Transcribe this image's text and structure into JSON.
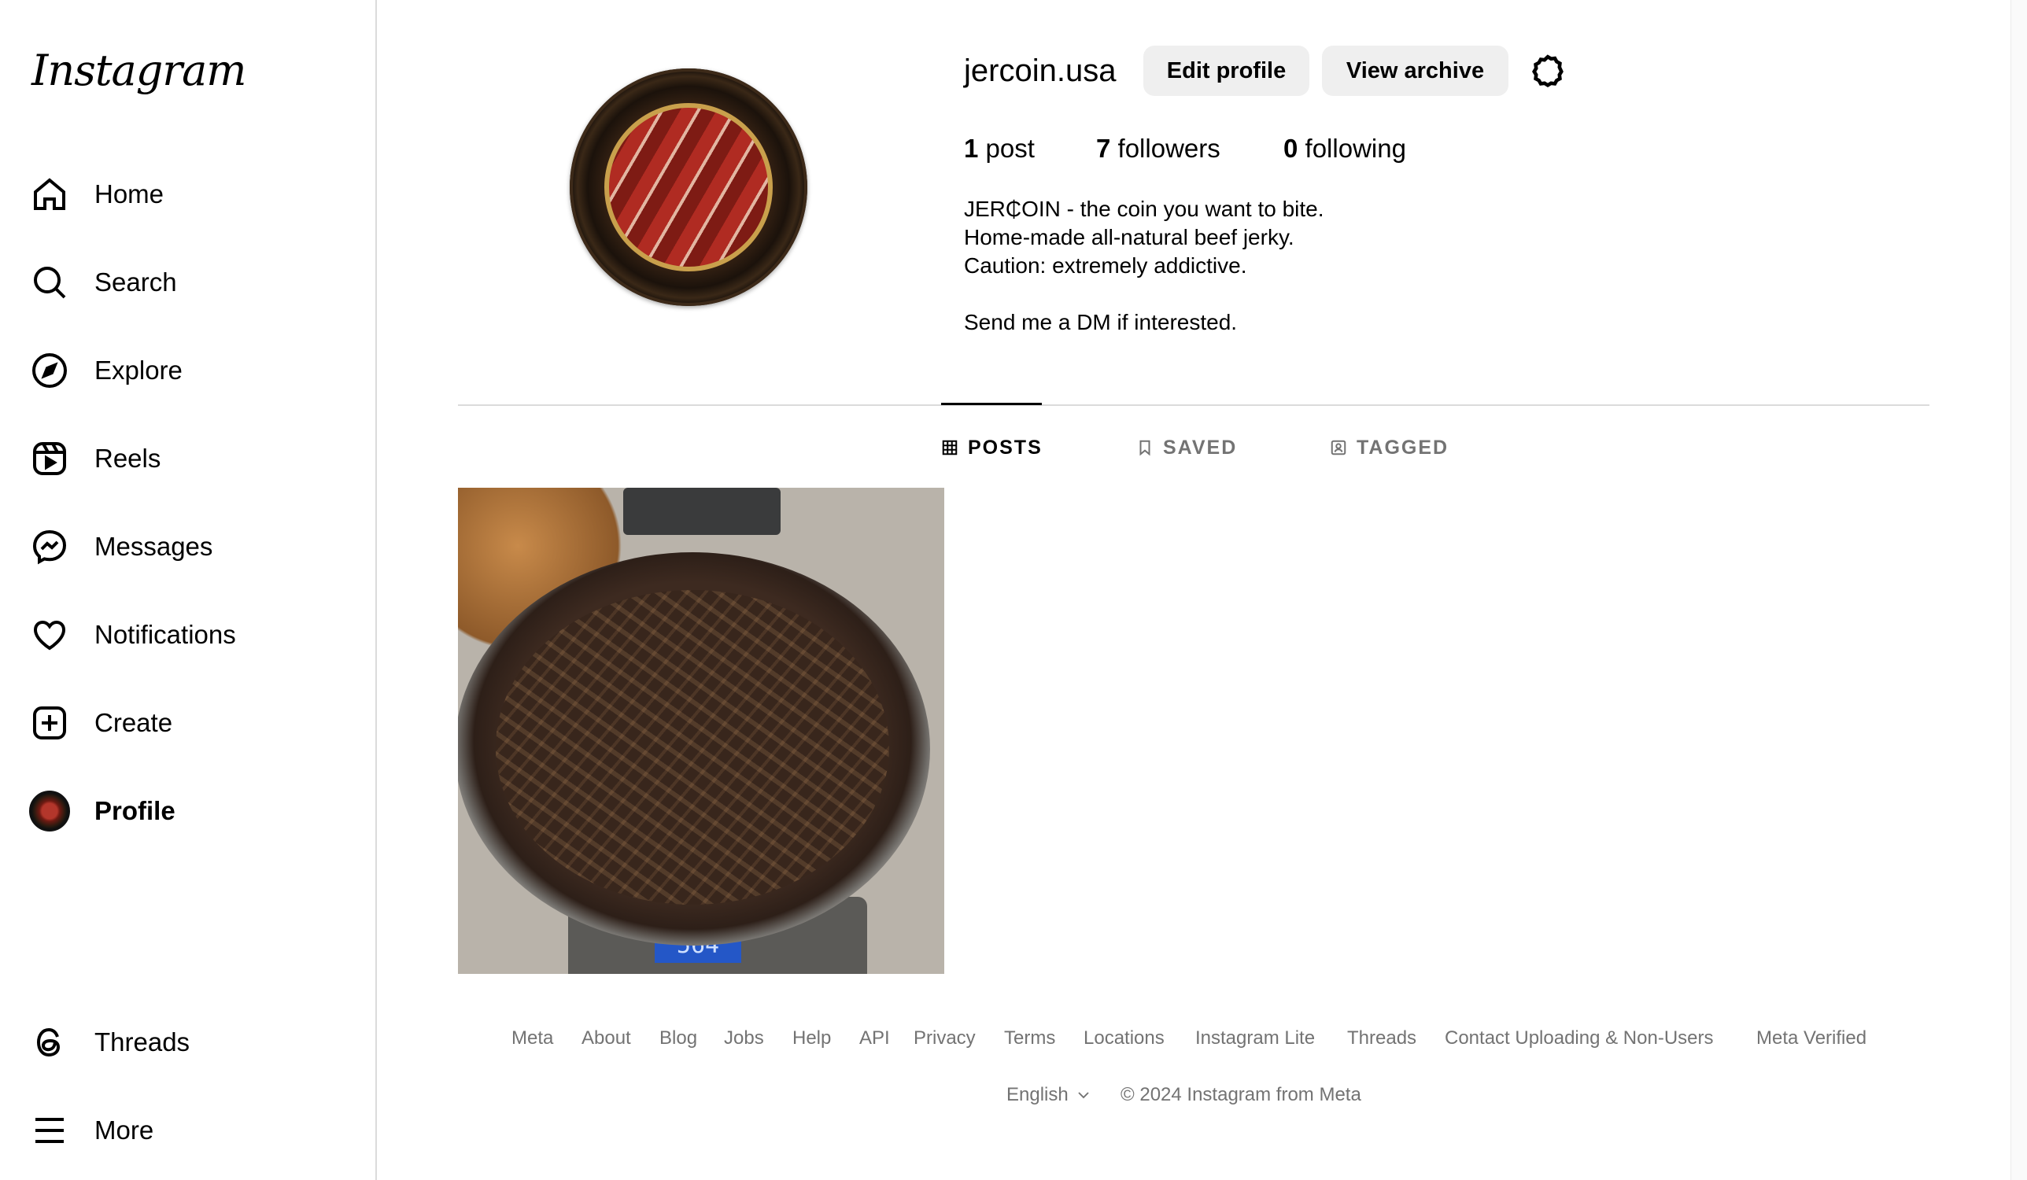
{
  "app": {
    "logo": "Instagram"
  },
  "sidebar": {
    "items": [
      {
        "label": "Home",
        "icon": "home-icon"
      },
      {
        "label": "Search",
        "icon": "search-icon"
      },
      {
        "label": "Explore",
        "icon": "compass-icon"
      },
      {
        "label": "Reels",
        "icon": "reels-icon"
      },
      {
        "label": "Messages",
        "icon": "messenger-icon"
      },
      {
        "label": "Notifications",
        "icon": "heart-icon"
      },
      {
        "label": "Create",
        "icon": "plus-square-icon"
      },
      {
        "label": "Profile",
        "icon": "avatar"
      }
    ],
    "bottom": [
      {
        "label": "Threads",
        "icon": "threads-icon"
      },
      {
        "label": "More",
        "icon": "menu-icon"
      }
    ]
  },
  "profile": {
    "username": "jercoin.usa",
    "edit_label": "Edit profile",
    "archive_label": "View archive",
    "posts_count": "1",
    "posts_label": "post",
    "followers_count": "7",
    "followers_label": "followers",
    "following_count": "0",
    "following_label": "following",
    "bio": [
      "JER₵OIN - the coin you want to bite.",
      "Home-made all-natural beef jerky.",
      "Caution: extremely addictive.",
      "",
      "Send me a DM if interested."
    ]
  },
  "tabs": [
    {
      "label": "POSTS",
      "icon": "grid-icon",
      "active": true
    },
    {
      "label": "SAVED",
      "icon": "bookmark-icon",
      "active": false
    },
    {
      "label": "TAGGED",
      "icon": "tagged-icon",
      "active": false
    }
  ],
  "post": {
    "scale_reading": "564"
  },
  "footer": {
    "links": [
      "Meta",
      "About",
      "Blog",
      "Jobs",
      "Help",
      "API",
      "Privacy",
      "Terms",
      "Locations",
      "Instagram Lite",
      "Threads",
      "Contact Uploading & Non-Users",
      "Meta Verified"
    ],
    "language": "English",
    "copyright": "© 2024 Instagram from Meta"
  },
  "colors": {
    "secondary_text": "#737373",
    "button_bg": "#efefef",
    "border": "#dbdbdb"
  }
}
